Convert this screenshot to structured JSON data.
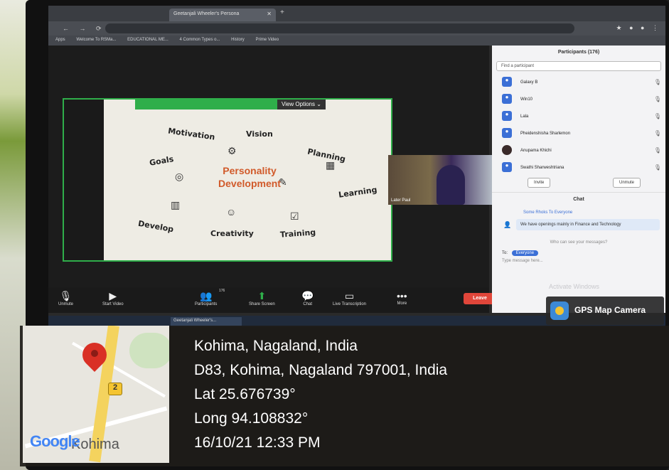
{
  "browser": {
    "tab_title": "Geetanjali Wheeler's Persona",
    "bookmarks": [
      "Apps",
      "Welcome To RSMa...",
      "EDUCATIONAL ME...",
      "4 Common Types o...",
      "History",
      "Prime Video"
    ]
  },
  "share": {
    "view_options": "View Options ⌄"
  },
  "slide": {
    "center_title": "Personality Development",
    "words": [
      "Motivation",
      "Vision",
      "Goals",
      "Planning",
      "Learning",
      "Develop",
      "Creativity",
      "Training"
    ]
  },
  "video": {
    "name": "Later Paul"
  },
  "toolbar": {
    "items": [
      "Unmute",
      "Start Video",
      "Participants",
      "Share Screen",
      "Chat",
      "Live Transcription",
      "More"
    ],
    "participants_count": "176",
    "leave": "Leave"
  },
  "participants": {
    "title": "Participants (176)",
    "find_placeholder": "Find a participant",
    "rows": [
      "Galaxy B",
      "Win10",
      "Lala",
      "Pheidenshisha Sharlemon",
      "Anupama Khichi",
      "Swathi Sharweshtriana"
    ],
    "invite": "Invite",
    "unmute_all": "Unmute"
  },
  "chat": {
    "title": "Chat",
    "from": "Some Rhoks To Everyone",
    "message": "We have openings mainly in Finance and Technology",
    "who_can_see": "Who can see your messages?",
    "to_label": "To:",
    "to_value": "Everyone",
    "placeholder": "Type message here...",
    "watermark": "Activate Windows"
  },
  "taskbar": {
    "active_item": "Geetanjali Wheeler's..."
  },
  "gps": {
    "app_name": "GPS Map Camera",
    "city": "Kohima, Nagaland, India",
    "address": "D83, Kohima, Nagaland 797001, India",
    "lat": "Lat 25.676739°",
    "long": "Long 94.108832°",
    "datetime": "16/10/21 12:33 PM",
    "map_brand": "Google",
    "map_city": "Kohima",
    "road_shield": "2"
  },
  "colors": {
    "share_border": "#2fae4a",
    "leave": "#e0463a",
    "pin": "#d93025"
  }
}
